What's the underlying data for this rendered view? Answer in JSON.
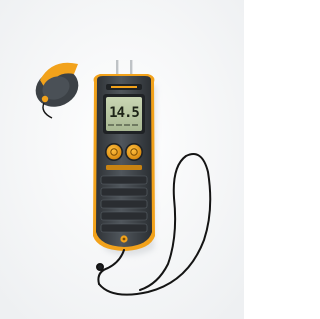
{
  "photo": {
    "subject_icon": "moisture-meter-icon",
    "colors": {
      "background": "#ffffff",
      "body": "#3b3f43",
      "accent": "#f2a21b",
      "lcd": "#b8c7a2",
      "lanyard": "#141414"
    }
  },
  "lcd": {
    "reading": "14.5"
  }
}
